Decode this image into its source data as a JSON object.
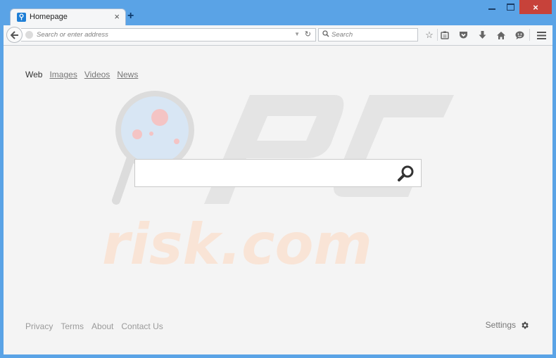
{
  "window": {
    "tab": {
      "title": "Homepage",
      "favicon": "search-logo-icon"
    },
    "new_tab_glyph": "+",
    "tab_close_glyph": "×",
    "controls": {
      "close_glyph": "×"
    }
  },
  "navbar": {
    "back_glyph": "🡐",
    "url_placeholder": "Search or enter address",
    "url_value": "",
    "dropdown_glyph": "▼",
    "reload_glyph": "↻",
    "search_placeholder": "Search",
    "search_value": "",
    "tools": [
      {
        "name": "bookmark-star-icon",
        "glyph": "☆"
      },
      {
        "name": "reading-list-icon",
        "glyph": "▤"
      },
      {
        "name": "pocket-icon",
        "glyph": "⛉"
      },
      {
        "name": "download-icon",
        "glyph": "⬇"
      },
      {
        "name": "home-icon",
        "glyph": "⌂"
      },
      {
        "name": "chat-icon",
        "glyph": "☻"
      },
      {
        "name": "menu-icon",
        "glyph": "☰"
      }
    ]
  },
  "page": {
    "search_tabs": [
      {
        "label": "Web",
        "active": true
      },
      {
        "label": "Images",
        "active": false
      },
      {
        "label": "Videos",
        "active": false
      },
      {
        "label": "News",
        "active": false
      }
    ],
    "search_value": "",
    "footer_links": [
      "Privacy",
      "Terms",
      "About",
      "Contact Us"
    ],
    "settings_label": "Settings",
    "watermark_text": "risk.com"
  },
  "colors": {
    "chrome_blue": "#5aa3e6",
    "close_red": "#c7423a",
    "page_bg": "#f4f4f4"
  }
}
